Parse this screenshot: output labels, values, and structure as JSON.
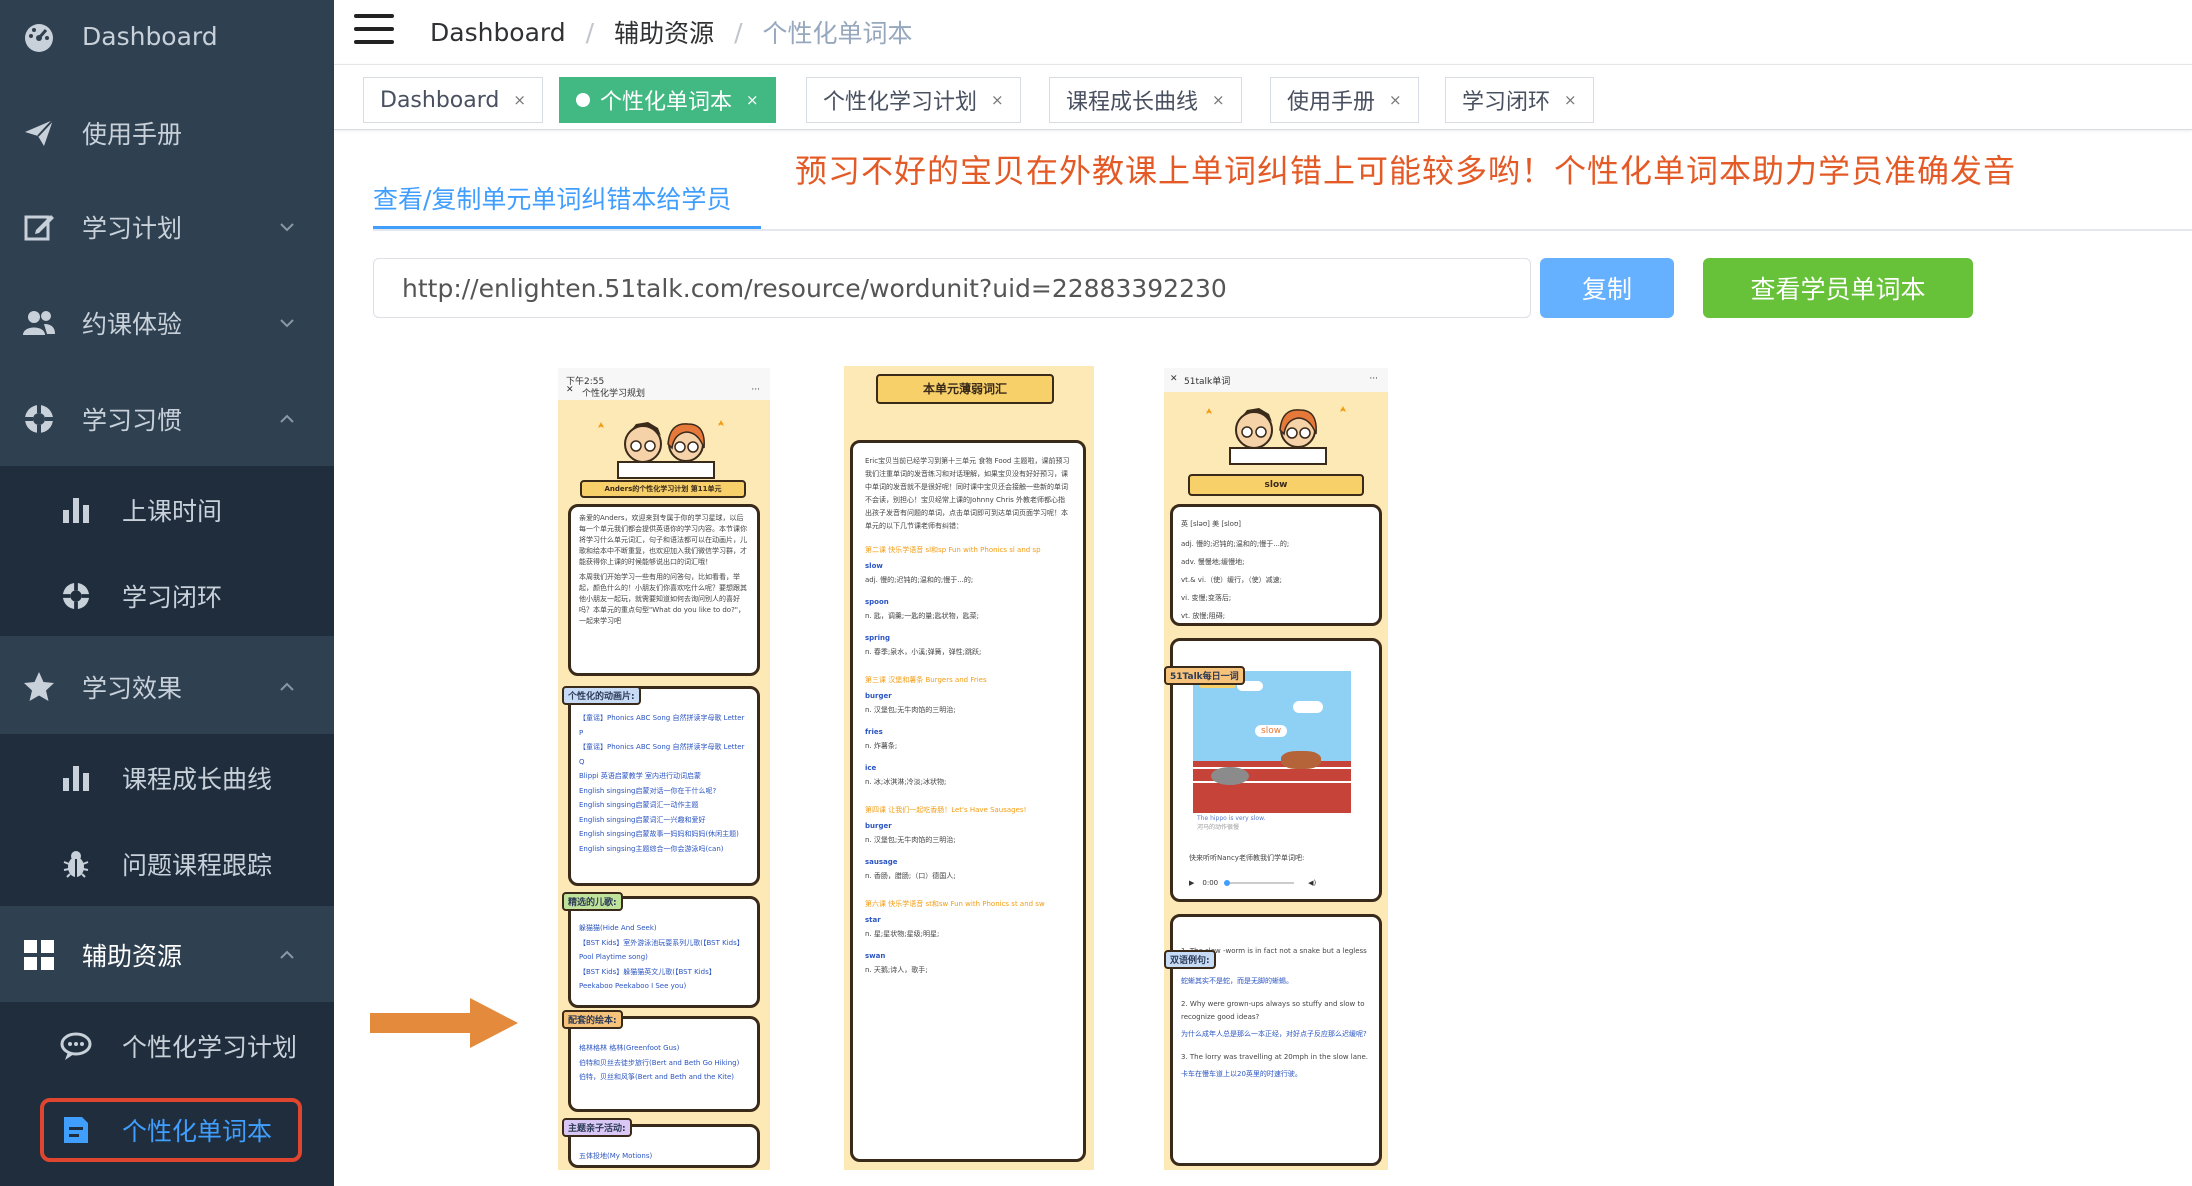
{
  "sidebar": {
    "items": [
      {
        "label": "Dashboard",
        "icon": "dashboard-icon"
      },
      {
        "label": "使用手册",
        "icon": "paper-plane-icon"
      },
      {
        "label": "学习计划",
        "icon": "edit-icon"
      },
      {
        "label": "约课体验",
        "icon": "users-icon"
      },
      {
        "label": "学习习惯",
        "icon": "lifebuoy-icon"
      },
      {
        "label": "学习效果",
        "icon": "star-icon"
      },
      {
        "label": "辅助资源",
        "icon": "grid-icon"
      }
    ],
    "sub_habits": [
      {
        "label": "上课时间",
        "icon": "bar-chart-icon"
      },
      {
        "label": "学习闭环",
        "icon": "lifebuoy-icon"
      }
    ],
    "sub_effect": [
      {
        "label": "课程成长曲线",
        "icon": "bar-chart-icon"
      },
      {
        "label": "问题课程跟踪",
        "icon": "bug-icon"
      }
    ],
    "sub_resources": [
      {
        "label": "个性化学习计划",
        "icon": "chat-icon"
      },
      {
        "label": "个性化单词本",
        "icon": "notebook-icon"
      }
    ]
  },
  "breadcrumb": [
    "Dashboard",
    "辅助资源",
    "个性化单词本"
  ],
  "tags": [
    "Dashboard",
    "个性化单词本",
    "个性化学习计划",
    "课程成长曲线",
    "使用手册",
    "学习闭环"
  ],
  "tag_close": "×",
  "section_tab": "查看/复制单元单词纠错本给学员",
  "promo_text": "预习不好的宝贝在外教课上单词纠错上可能较多哟！个性化单词本助力学员准确发音",
  "url_value": "http://enlighten.51talk.com/resource/wordunit?uid=22883392230",
  "copy_button": "复制",
  "view_button": "查看学员单词本",
  "colors": {
    "sidebar_bg": "#2f4050",
    "submenu_bg": "#1f2d3d",
    "active_tag": "#42b983",
    "primary": "#409eff",
    "success": "#67c23a",
    "promo": "#e45a26"
  },
  "phone1": {
    "time": "下午2:55",
    "title": "个性化学习规划",
    "banner": "Anders的个性化学习计划 第11单元",
    "intro": "亲爱的Anders，欢迎来到专属于你的学习星球，以后每一个单元我们都会提供英语你的学习内容。本节课你将学习什么单元词汇，句子和语法都可以在动画片，儿歌和绘本中不断重复，也欢迎加入我们微信学习群，才能获得你上课的时候能够说出口的词汇哦！",
    "intro2": "本周我们开始学习一些有用的问答句，比如看看，举起，颜色什么的！小朋友们你喜欢吃什么呢？要想跟其他小朋友一起玩，就需要知道如何去询问别人的喜好吗？本单元的重点句型\"What do you like to do?\"，一起来学习吧",
    "sec_animation": "个性化的动画片:",
    "animation_items": [
      "【童谣】Phonics ABC Song 自然拼读字母歌 Letter P",
      "【童谣】Phonics ABC Song 自然拼读字母歌 Letter Q",
      "Blippi 英语启蒙教学 室内进行动词启蒙",
      "English singsing启蒙对话一你在干什么呢?",
      "English singsing启蒙词汇一动作主题",
      "English singsing启蒙词汇一兴趣和爱好",
      "English singsing启蒙故事一妈妈和妈妈(休闲主题)",
      "English singsing主题综合一你会游泳吗(can)"
    ],
    "sec_songs": "精选的儿歌:",
    "song_items": [
      "躲猫猫(Hide And Seek)",
      "【BST Kids】室外游泳池玩耍系列儿歌(【BST Kids】Pool Playtime song)",
      "【BST Kids】躲猫猫英文儿歌(【BST Kids】Peekaboo Peekaboo I See you)"
    ],
    "sec_books": "配套的绘本:",
    "book_items": [
      "格林格林 格林(Greenfoot Gus)",
      "伯特和贝丝去徒步旅行(Bert and Beth Go Hiking)",
      "伯特，贝丝和风筝(Bert and Beth and the Kite)"
    ],
    "sec_activity": "主题亲子活动:",
    "activity_items": [
      "五体投地(My Motions)"
    ]
  },
  "phone2": {
    "banner": "本单元薄弱词汇",
    "intro": "Eric宝贝当前已经学习到第十三单元 食物 Food 主题啦，课前预习我们注重单词的发音练习和对话理解，如果宝贝没有好好预习，课中单词的发音就不是很好呢！同时课中宝贝还会接触一些新的单词不会读，别担心！宝贝经常上课的Johnny Chris 外教老师都心指出孩子发音有问题的单词，点击单词即可到达单词页面学习呢！本单元的以下几节课老师有纠错：",
    "lessons": [
      {
        "title": "第二课 快乐学语音 sl和sp Fun with Phonics sl and sp",
        "words": [
          {
            "word": "slow",
            "meaning": "adj. 慢的;迟钝的;温和的;慢于...的;"
          },
          {
            "word": "spoon",
            "meaning": "n. 匙，调羹;一匙的量;匙状物，匙菜;"
          },
          {
            "word": "spring",
            "meaning": "n. 春季;泉水，小溪;弹簧，弹性;跳跃;"
          }
        ]
      },
      {
        "title": "第三课 汉堡和薯条 Burgers and Fries",
        "words": [
          {
            "word": "burger",
            "meaning": "n. 汉堡包;无牛肉馅的三明治;"
          },
          {
            "word": "fries",
            "meaning": "n. 炸薯条;"
          },
          {
            "word": "ice",
            "meaning": "n. 冰;冰淇淋;冷淡;冰状物;"
          }
        ]
      },
      {
        "title": "第四课 让我们一起吃香肠！Let's Have Sausages!",
        "words": [
          {
            "word": "burger",
            "meaning": "n. 汉堡包;无牛肉馅的三明治;"
          },
          {
            "word": "sausage",
            "meaning": "n. 香肠，腊肠;（口）德国人;"
          }
        ]
      },
      {
        "title": "第六课 快乐学语音 st和sw Fun with Phonics st and sw",
        "words": [
          {
            "word": "star",
            "meaning": "n. 星;星状物;星级;明星;"
          },
          {
            "word": "swan",
            "meaning": "n. 天鹅;诗人，歌手;"
          }
        ]
      }
    ]
  },
  "phone3": {
    "title": "51talk单词",
    "banner": "slow",
    "phonetic": "英 [sləʊ]    美 [sloʊ]",
    "defs": [
      "adj. 慢的;迟钝的;温和的;慢于...的;",
      "adv. 慢慢地;缓慢地;",
      "vt.& vi.（使）缓行，（使）减速;",
      "vi. 变慢;变落后;",
      "vt. 放慢;阻碍;"
    ],
    "sec_daily": "51Talk每日一词",
    "video_brand": "51Talk",
    "video_word": "slow",
    "video_caption": "The hippo is very slow.",
    "video_caption_cn": "河马的动作很慢",
    "teacher_line": "快来听听Nancy老师教我们学单词吧:",
    "audio_time": "0:00",
    "sec_examples": "双语例句:",
    "examples": [
      {
        "en": "1. The slow -worm is in fact not a snake but a legless lizard.",
        "cn": "蛇蜥其实不是蛇，而是无脚的蜥蜴。"
      },
      {
        "en": "2. Why were grown-ups always so stuffy and slow to recognize good ideas?",
        "cn": "为什么成年人总是那么一本正经，对好点子反应那么迟缓呢?"
      },
      {
        "en": "3. The lorry was travelling at 20mph in the slow lane.",
        "cn": "卡车在慢车道上以20英里的时速行驶。"
      }
    ]
  }
}
